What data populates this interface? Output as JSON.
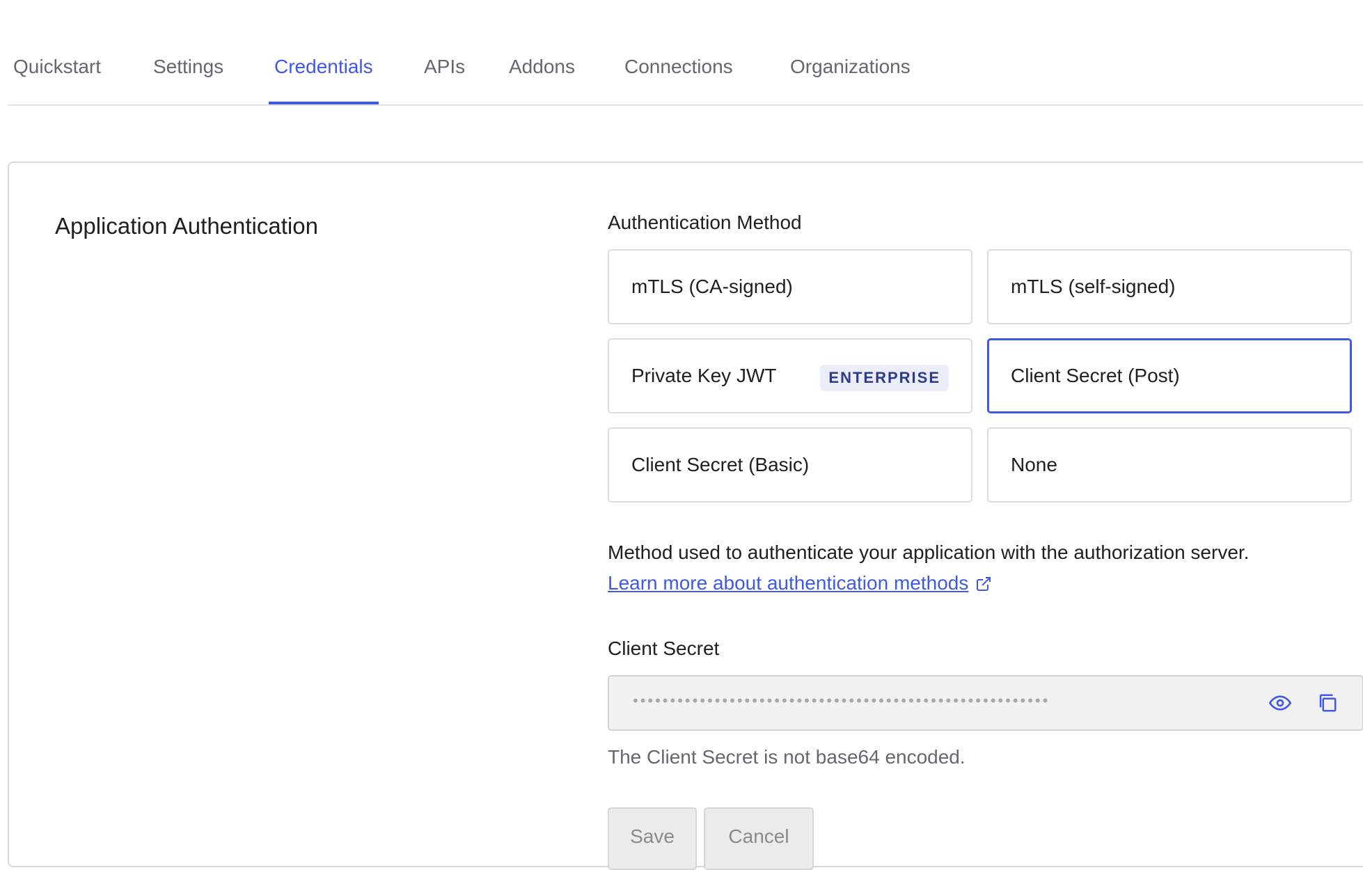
{
  "tabs": [
    {
      "label": "Quickstart",
      "active": false
    },
    {
      "label": "Settings",
      "active": false
    },
    {
      "label": "Credentials",
      "active": true
    },
    {
      "label": "APIs",
      "active": false
    },
    {
      "label": "Addons",
      "active": false
    },
    {
      "label": "Connections",
      "active": false
    },
    {
      "label": "Organizations",
      "active": false
    }
  ],
  "section": {
    "title": "Application Authentication"
  },
  "auth": {
    "label": "Authentication Method",
    "options": [
      {
        "label": "mTLS (CA-signed)",
        "selected": false
      },
      {
        "label": "mTLS (self-signed)",
        "selected": false
      },
      {
        "label": "Private Key JWT",
        "badge": "ENTERPRISE",
        "selected": false
      },
      {
        "label": "Client Secret (Post)",
        "selected": true
      },
      {
        "label": "Client Secret (Basic)",
        "selected": false
      },
      {
        "label": "None",
        "selected": false
      }
    ],
    "help_text": "Method used to authenticate your application with the authorization server.",
    "learn_more_link": "Learn more about authentication methods"
  },
  "client_secret": {
    "label": "Client Secret",
    "masked_value": "••••••••••••••••••••••••••••••••••••••••••••••••••••••••",
    "note": "The Client Secret is not base64 encoded.",
    "icons": {
      "reveal": "eye-icon",
      "copy": "copy-icon"
    }
  },
  "actions": {
    "save_label": "Save",
    "cancel_label": "Cancel"
  },
  "colors": {
    "accent": "#3f59e4",
    "badge_bg": "#ebedf9",
    "badge_text": "#2b3a8f"
  }
}
